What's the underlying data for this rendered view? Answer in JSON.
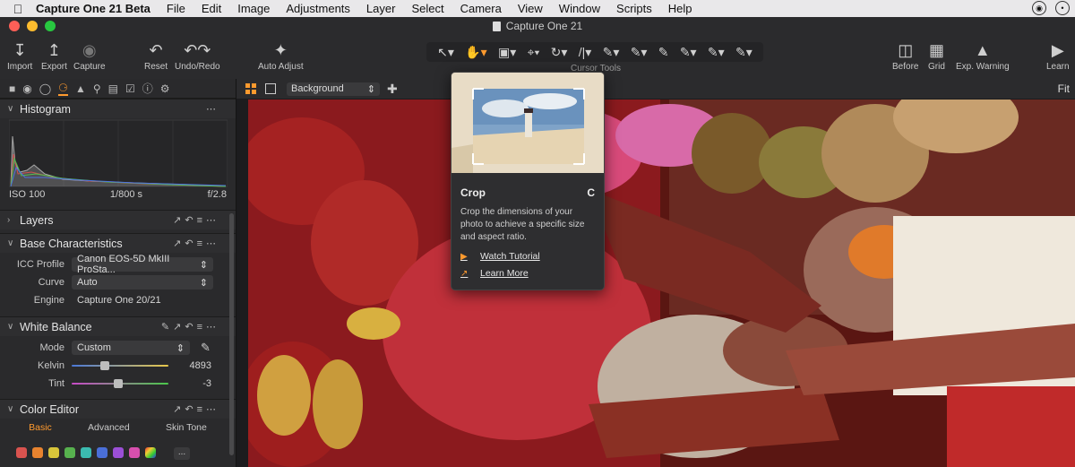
{
  "menubar": {
    "app_name": "Capture One 21 Beta",
    "items": [
      "File",
      "Edit",
      "Image",
      "Adjustments",
      "Layer",
      "Select",
      "Camera",
      "View",
      "Window",
      "Scripts",
      "Help"
    ]
  },
  "window": {
    "title": "Capture One 21"
  },
  "toolbar": {
    "import_label": "Import",
    "export_label": "Export",
    "capture_label": "Capture",
    "reset_label": "Reset",
    "undo_redo_label": "Undo/Redo",
    "auto_adjust_label": "Auto Adjust",
    "cursor_tools_label": "Cursor Tools",
    "before_label": "Before",
    "grid_label": "Grid",
    "exp_warning_label": "Exp. Warning",
    "learn_label": "Learn"
  },
  "histogram": {
    "title": "Histogram",
    "iso": "ISO 100",
    "shutter": "1/800 s",
    "aperture": "f/2.8"
  },
  "layers": {
    "title": "Layers"
  },
  "base_characteristics": {
    "title": "Base Characteristics",
    "icc_label": "ICC Profile",
    "icc_value": "Canon EOS-5D MkIII ProSta...",
    "curve_label": "Curve",
    "curve_value": "Auto",
    "engine_label": "Engine",
    "engine_value": "Capture One 20/21"
  },
  "white_balance": {
    "title": "White Balance",
    "mode_label": "Mode",
    "mode_value": "Custom",
    "kelvin_label": "Kelvin",
    "kelvin_value": "4893",
    "kelvin_level": 0.33,
    "tint_label": "Tint",
    "tint_value": "-3",
    "tint_level": 0.48
  },
  "color_editor": {
    "title": "Color Editor",
    "tabs": [
      "Basic",
      "Advanced",
      "Skin Tone"
    ],
    "swatch_colors": [
      "#d9534f",
      "#e8832f",
      "#d8c53a",
      "#57b14e",
      "#3bbbb0",
      "#4a6fd8",
      "#9b4fd6",
      "#d84fae"
    ],
    "more_label": "..."
  },
  "viewer": {
    "background_label": "Background",
    "fit_label": "Fit"
  },
  "tooltip": {
    "title": "Crop",
    "shortcut": "C",
    "description": "Crop the dimensions of your photo to achieve a specific size and aspect ratio.",
    "watch_tutorial": "Watch Tutorial",
    "learn_more": "Learn More"
  },
  "colors": {
    "accent": "#ff9a2e",
    "panel": "#2a2a2c",
    "toolbar": "#2b2b2d"
  }
}
